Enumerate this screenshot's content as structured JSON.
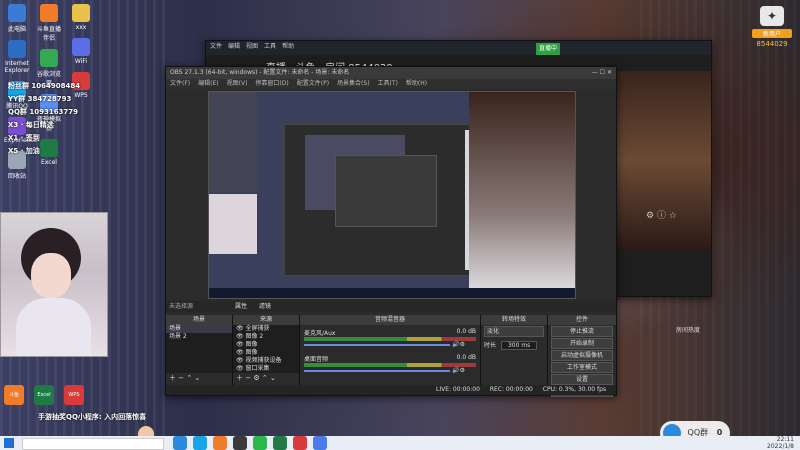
{
  "desktop": {
    "icons_col1": [
      {
        "label": "此电脑",
        "color": "#3a7bd5"
      },
      {
        "label": "Internet Explorer",
        "color": "#2b6cc4"
      },
      {
        "label": "腾讯QQ",
        "color": "#19a3e8"
      },
      {
        "label": "Experience",
        "color": "#7a4fd1"
      },
      {
        "label": "回收站",
        "color": "#9aa7b7"
      }
    ],
    "icons_col2": [
      {
        "label": "斗鱼直播伴侣",
        "color": "#f07c2a"
      },
      {
        "label": "谷歌浏览器",
        "color": "#35a853"
      },
      {
        "label": "夜神模拟器",
        "color": "#5d8ef0"
      },
      {
        "label": "Excel",
        "color": "#1f7a45"
      }
    ],
    "icons_col3": [
      {
        "label": "xxx",
        "color": "#e8c24a"
      },
      {
        "label": "WiFi",
        "color": "#5b6ee8"
      },
      {
        "label": "WPS",
        "color": "#d93a3a"
      }
    ],
    "overlay_lines": [
      "粉丝群 1064908484",
      "YY群 384728793",
      "QQ群 1093163779",
      "X3 · 每日精选",
      "X1 · 签到",
      "X5 · 加油"
    ],
    "marquee": "手游抽奖QQ小程序: 入内回落惊喜",
    "bottom_icons": [
      {
        "label": "斗鱼",
        "color": "#f07c2a"
      },
      {
        "label": "Excel",
        "color": "#1f7a45"
      },
      {
        "label": "WPS",
        "color": "#d93a3a"
      }
    ]
  },
  "back_window": {
    "title": "直播 · 斗鱼 · 房间 8544029",
    "menu": [
      "文件",
      "编辑",
      "视图",
      "工具",
      "帮助"
    ],
    "toolbar_badge": "直播中"
  },
  "obs": {
    "title": "OBS 27.1.3 (64-bit, windows) - 配置文件: 未命名 - 场景: 未命名",
    "menu": [
      "文件(F)",
      "编辑(E)",
      "视图(V)",
      "停靠窗口(D)",
      "配置文件(P)",
      "场景集合(S)",
      "工具(T)",
      "帮助(H)"
    ],
    "preview_label": "未选择源",
    "source_tabs": [
      "属性",
      "滤镜"
    ],
    "docks": {
      "scenes": {
        "title": "场景",
        "items": [
          "场景",
          "场景 2"
        ]
      },
      "sources": {
        "title": "来源",
        "items": [
          "全屏捕获",
          "图像 2",
          "图像",
          "图像",
          "视频捕获设备",
          "窗口采集"
        ]
      },
      "mixer": {
        "title": "音频混音器",
        "channels": [
          {
            "name": "麦克风/Aux",
            "level": "0.0 dB"
          },
          {
            "name": "桌面音频",
            "level": "0.0 dB"
          }
        ]
      },
      "transitions": {
        "title": "转场特效",
        "type": "淡化",
        "duration_label": "时长",
        "duration": "300 ms"
      },
      "controls": {
        "title": "控件",
        "buttons": [
          "停止推流",
          "开始录制",
          "启动虚拟摄像机",
          "工作室模式",
          "设置",
          "退出"
        ]
      }
    },
    "status": {
      "live": "LIVE: 00:00:00",
      "rec": "REC: 00:00:00",
      "cpu": "CPU: 0.3%, 30.00 fps"
    }
  },
  "right_panel": {
    "badge": "新用户",
    "room_id": "8544029",
    "footer": "房间热度"
  },
  "taskbar": {
    "search_placeholder": "",
    "apps": [
      {
        "name": "Edge",
        "color": "#2b8ae0"
      },
      {
        "name": "QQ",
        "color": "#19a3e8"
      },
      {
        "name": "斗鱼",
        "color": "#f07c2a"
      },
      {
        "name": "OBS",
        "color": "#3a3a3a"
      },
      {
        "name": "微信",
        "color": "#2ab84a"
      },
      {
        "name": "Excel",
        "color": "#1f7a45"
      },
      {
        "name": "网易云",
        "color": "#d93a3a"
      },
      {
        "name": "浏览器",
        "color": "#4a7be8"
      }
    ],
    "tray_time": "22:11",
    "tray_date": "2022/1/8"
  },
  "qq_float": {
    "label": "QQ群",
    "count": "0"
  }
}
